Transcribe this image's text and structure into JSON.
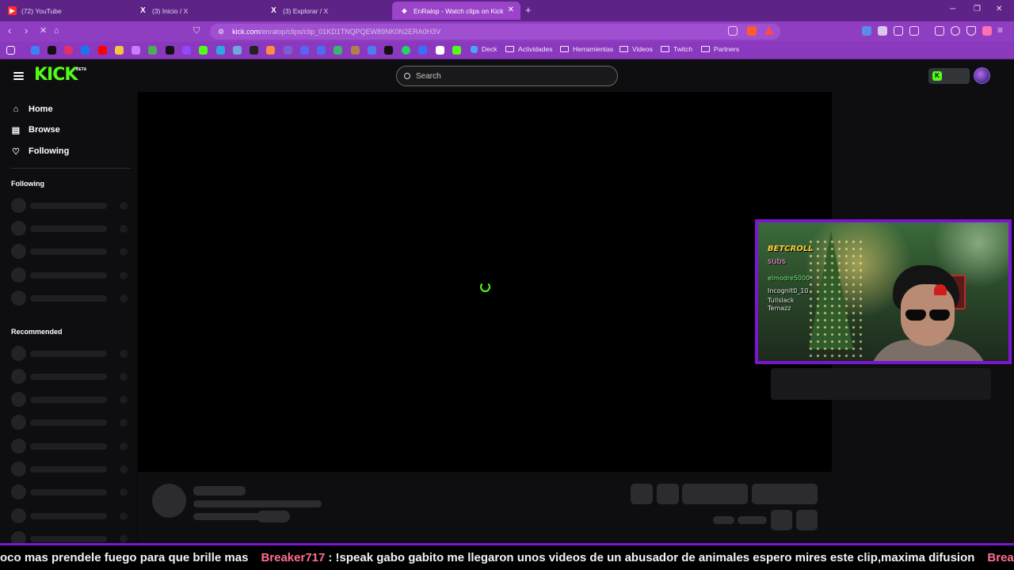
{
  "browser": {
    "tabs": [
      {
        "label": "(72) YouTube",
        "icon": "youtube-icon"
      },
      {
        "label": "(3) Inicio / X",
        "icon": "x-icon"
      },
      {
        "label": "(3) Explorar / X",
        "icon": "x-icon"
      },
      {
        "label": "EnRalop - Watch clips on Kick",
        "icon": "kick-icon",
        "active": true
      }
    ],
    "new_tab": "+",
    "url_host": "kick.com",
    "url_path": "/enralop/clips/clip_01KD1TNQPQEW89NK0N2ERA0H3V",
    "bookmarks": [
      "Deck",
      "Actividades",
      "Herramientas",
      "Videos",
      "Twitch",
      "Partners"
    ]
  },
  "kick": {
    "logo": "KICK",
    "beta": "BETA",
    "search_placeholder": "Search",
    "nav": [
      {
        "label": "Home",
        "icon": "home-icon"
      },
      {
        "label": "Browse",
        "icon": "browse-icon"
      },
      {
        "label": "Following",
        "icon": "heart-icon"
      }
    ],
    "sections": {
      "following": "Following",
      "recommended": "Recommended"
    }
  },
  "webcam": {
    "brand": "BETCROLL",
    "lines": [
      "subs",
      "elmodre5000",
      "Incognit0_10",
      "Tullslack",
      "Temazz"
    ]
  },
  "ticker": {
    "prefix": "oco mas prendele fuego para que brille mas",
    "user": "Breaker717",
    "message": ": !speak gabo gabito me llegaron unos videos de un abusador de animales espero mires este clip,maxima difusion",
    "user2": "Breaker"
  },
  "colors": {
    "brand": "#53fc18",
    "browser_frame": "#8f3ec2",
    "webcam_border": "#7a16cf",
    "ticker_user": "#ff6f8f"
  }
}
